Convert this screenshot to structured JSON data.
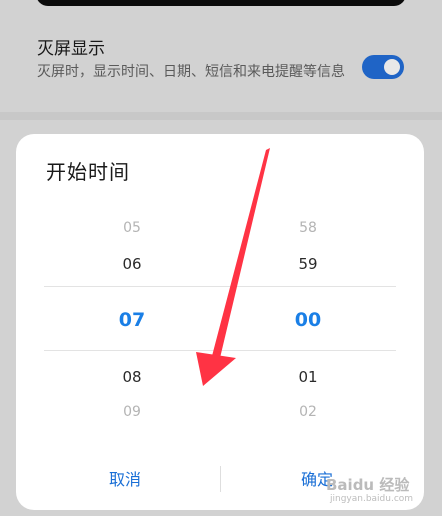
{
  "background": {
    "setting_title": "灭屏显示",
    "setting_desc": "灭屏时，显示时间、日期、短信和来电提醒等信息",
    "toggle_on": true
  },
  "dialog": {
    "title": "开始时间",
    "hours": {
      "prev2": "05",
      "prev1": "06",
      "selected": "07",
      "next1": "08",
      "next2": "09"
    },
    "minutes": {
      "prev2": "58",
      "prev1": "59",
      "selected": "00",
      "next1": "01",
      "next2": "02"
    },
    "cancel_label": "取消",
    "confirm_label": "确定"
  },
  "watermark": {
    "text": "Baidu 经验",
    "url": "jingyan.baidu.com"
  },
  "colors": {
    "accent": "#1a7fe6",
    "button": "#1a6fd6",
    "toggle": "#1f64c6",
    "arrow": "#ff3344"
  }
}
